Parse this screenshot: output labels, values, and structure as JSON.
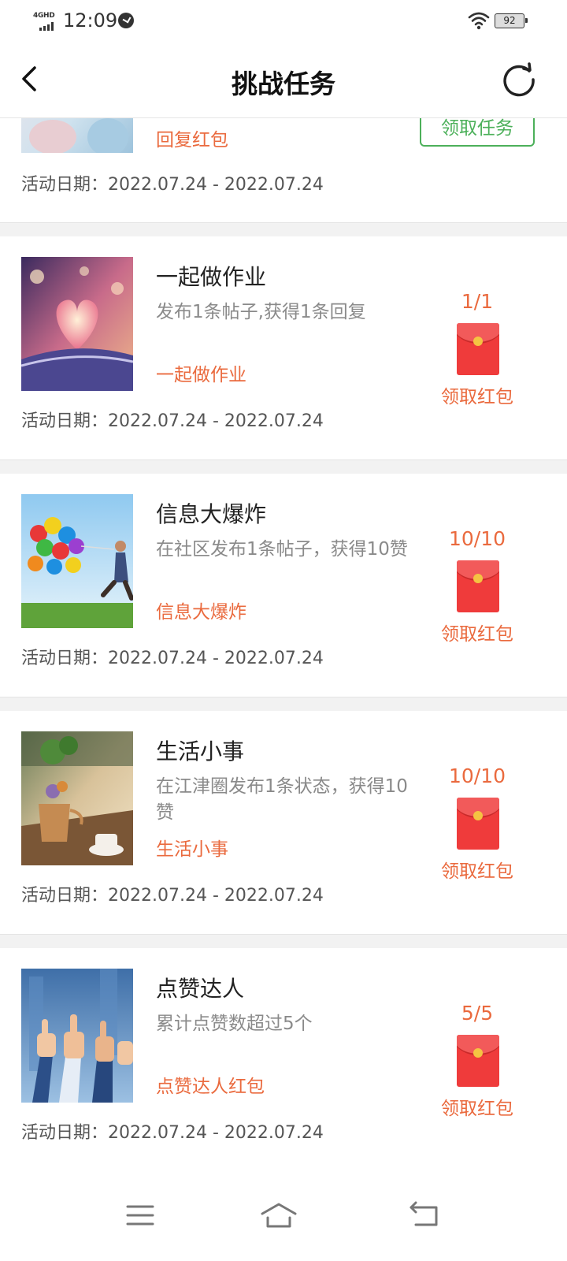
{
  "status_bar": {
    "network": "4GHD",
    "time": "12:09",
    "battery": "92"
  },
  "header": {
    "title": "挑战任务",
    "back_icon": "chevron-left-icon",
    "refresh_icon": "refresh-icon"
  },
  "partial_card": {
    "tag": "回复红包",
    "button": "领取任务",
    "date": "活动日期：2022.07.24 - 2022.07.24"
  },
  "tasks": [
    {
      "title": "一起做作业",
      "desc": "发布1条帖子,获得1条回复",
      "tag": "一起做作业",
      "progress": "1/1",
      "claim": "领取红包",
      "date": "活动日期：2022.07.24 - 2022.07.24"
    },
    {
      "title": "信息大爆炸",
      "desc": "在社区发布1条帖子，获得10赞",
      "tag": "信息大爆炸",
      "progress": "10/10",
      "claim": "领取红包",
      "date": "活动日期：2022.07.24 - 2022.07.24"
    },
    {
      "title": "生活小事",
      "desc": "在江津圈发布1条状态，获得10赞",
      "tag": "生活小事",
      "progress": "10/10",
      "claim": "领取红包",
      "date": "活动日期：2022.07.24 - 2022.07.24"
    },
    {
      "title": "点赞达人",
      "desc": "累计点赞数超过5个",
      "tag": "点赞达人红包",
      "progress": "5/5",
      "claim": "领取红包",
      "date": "活动日期：2022.07.24 - 2022.07.24"
    }
  ],
  "colors": {
    "accent": "#ea6a3e",
    "green": "#4cb05a",
    "envelope": "#ef3b3b"
  },
  "nav_bar": {
    "menu_icon": "menu-icon",
    "home_icon": "home-icon",
    "back_icon": "back-icon"
  }
}
